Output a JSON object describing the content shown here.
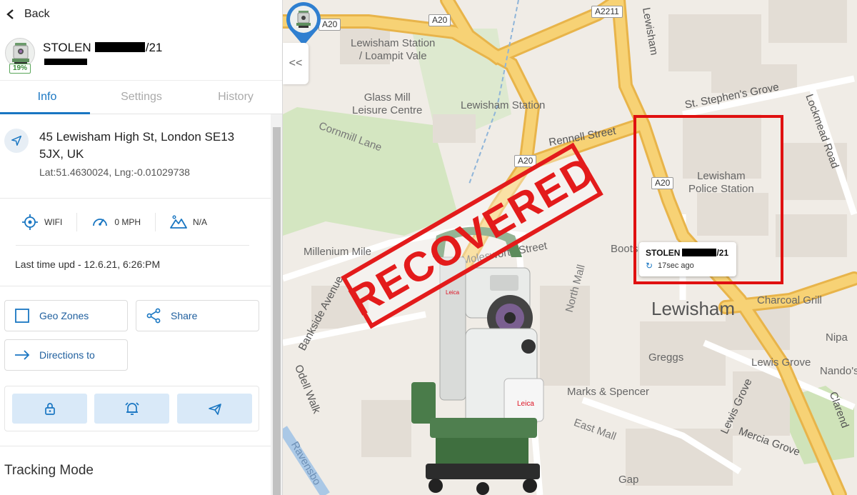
{
  "sidebar": {
    "back_label": "Back",
    "device": {
      "title_prefix": "STOLEN",
      "title_suffix": "/21",
      "battery": "19%"
    },
    "tabs": [
      {
        "label": "Info"
      },
      {
        "label": "Settings"
      },
      {
        "label": "History"
      }
    ],
    "location": {
      "address": "45 Lewisham High St, London SE13 5JX, UK",
      "coords": "Lat:51.4630024,  Lng:-0.01029738"
    },
    "stats": {
      "connection": "WIFI",
      "speed": "0 MPH",
      "altitude": "N/A"
    },
    "last_update": "Last time upd - 12.6.21, 6:26:PM",
    "buttons": {
      "geo_zones": "Geo Zones",
      "share": "Share",
      "directions": "Directions to"
    },
    "quick_actions": [
      "lock-icon",
      "alarm-bell-icon",
      "airplane-icon"
    ],
    "tracking_mode": "Tracking Mode",
    "collapse_label": "<<"
  },
  "map": {
    "town": "Lewisham",
    "places": {
      "lewisham_station_dlr": "Lewisham Station\n/ Loampit Vale",
      "glass_mill": "Glass Mill\nLeisure Centre",
      "lewisham_station": "Lewisham Station",
      "police_station": "Lewisham\nPolice Station",
      "millenium": "Millenium Mile",
      "boots": "Boots",
      "greggs": "Greggs",
      "marks": "Marks & Spencer",
      "charcoal": "Charcoal Grill",
      "nipa": "Nipa",
      "nandos": "Nando's",
      "gap": "Gap",
      "lewis_grove_shop": "Lewis Grove",
      "molesworth": "Molesworth Street"
    },
    "roads": {
      "cornmill": "Cornmill Lane",
      "rennell": "Rennell Street",
      "st_stephens": "St. Stephen's Grove",
      "lockmead": "Lockmead Road",
      "lewisham_road": "Lewisham",
      "bankside": "Bankside Avenue",
      "odell": "Odell Walk",
      "ravensbourne": "Ravensbo",
      "north_mall": "North Mall",
      "east_mall": "East Mall",
      "lewis_grove": "Lewis Grove",
      "mercia": "Mercia Grove",
      "clarendon": "Clarend"
    },
    "road_badges": [
      "A20",
      "A20",
      "A2211",
      "A20",
      "A20"
    ],
    "marker": {
      "title_prefix": "STOLEN",
      "title_suffix": "/21",
      "updated": "17sec ago"
    },
    "stamp": "RECOVERED"
  },
  "colors": {
    "accent": "#1976c2",
    "stamp_red": "#e31b1b",
    "highlight_red": "#e01010",
    "road_yellow": "#f6cf6a",
    "park_green": "#cfe3b9"
  }
}
